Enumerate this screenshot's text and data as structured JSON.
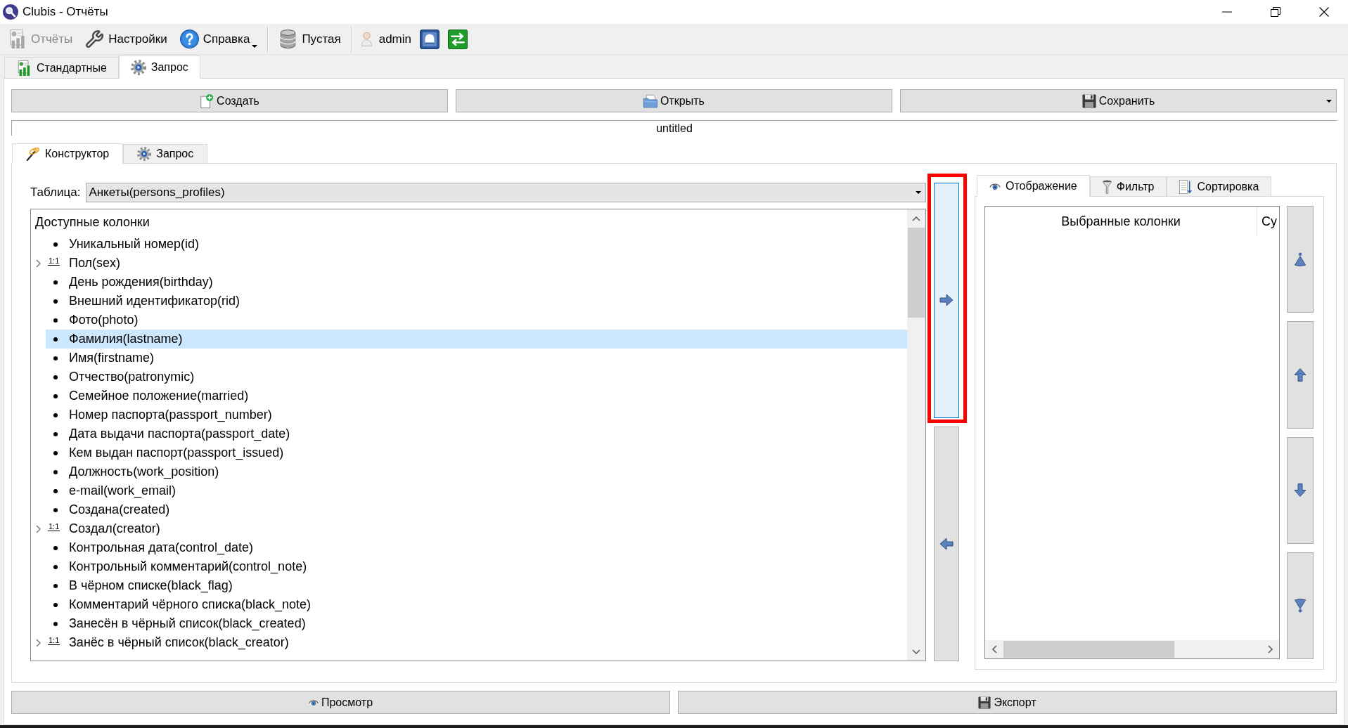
{
  "window": {
    "title": "Clubis - Отчёты"
  },
  "toolbar": [
    {
      "kind": "button",
      "label": "Отчёты",
      "disabled": true,
      "dropdown": false
    },
    {
      "kind": "button",
      "label": "Настройки",
      "disabled": false,
      "dropdown": false
    },
    {
      "kind": "button",
      "label": "Справка",
      "disabled": false,
      "dropdown": true
    },
    {
      "kind": "separator"
    },
    {
      "kind": "button",
      "label": "Пустая",
      "disabled": false,
      "dropdown": false
    },
    {
      "kind": "separator"
    },
    {
      "kind": "user",
      "label": "admin"
    },
    {
      "kind": "icon_button"
    },
    {
      "kind": "icon_button"
    }
  ],
  "main_tabs": [
    {
      "label": "Стандартные",
      "selected": false
    },
    {
      "label": "Запрос",
      "selected": true
    }
  ],
  "file_buttons": [
    {
      "label": "Создать",
      "dropdown": false
    },
    {
      "label": "Открыть",
      "dropdown": false
    },
    {
      "label": "Сохранить",
      "dropdown": true
    }
  ],
  "query_name": {
    "value": "untitled"
  },
  "editor_tabs": [
    {
      "label": "Конструктор",
      "selected": true
    },
    {
      "label": "Запрос",
      "selected": false
    }
  ],
  "table_select": {
    "label": "Таблица:",
    "value": "Анкеты(persons_profiles)"
  },
  "available_columns": {
    "header": "Доступные колонки",
    "items": [
      {
        "kind": "field",
        "label": "Уникальный номер(id)",
        "selected": false
      },
      {
        "kind": "relation",
        "label": "Пол(sex)",
        "relation": "1:1",
        "expanded": false,
        "selected": false
      },
      {
        "kind": "field",
        "label": "День рождения(birthday)",
        "selected": false
      },
      {
        "kind": "field",
        "label": "Внешний идентификатор(rid)",
        "selected": false
      },
      {
        "kind": "field",
        "label": "Фото(photo)",
        "selected": false
      },
      {
        "kind": "field",
        "label": "Фамилия(lastname)",
        "selected": true
      },
      {
        "kind": "field",
        "label": "Имя(firstname)",
        "selected": false
      },
      {
        "kind": "field",
        "label": "Отчество(patronymic)",
        "selected": false
      },
      {
        "kind": "field",
        "label": "Семейное положение(married)",
        "selected": false
      },
      {
        "kind": "field",
        "label": "Номер паспорта(passport_number)",
        "selected": false
      },
      {
        "kind": "field",
        "label": "Дата выдачи паспорта(passport_date)",
        "selected": false
      },
      {
        "kind": "field",
        "label": "Кем выдан паспорт(passport_issued)",
        "selected": false
      },
      {
        "kind": "field",
        "label": "Должность(work_position)",
        "selected": false
      },
      {
        "kind": "field",
        "label": "e-mail(work_email)",
        "selected": false
      },
      {
        "kind": "field",
        "label": "Создана(created)",
        "selected": false
      },
      {
        "kind": "relation",
        "label": "Создал(creator)",
        "relation": "1:1",
        "expanded": false,
        "selected": false
      },
      {
        "kind": "field",
        "label": "Контрольная дата(control_date)",
        "selected": false
      },
      {
        "kind": "field",
        "label": "Контрольный комментарий(control_note)",
        "selected": false
      },
      {
        "kind": "field",
        "label": "В чёрном списке(black_flag)",
        "selected": false
      },
      {
        "kind": "field",
        "label": "Комментарий чёрного списка(black_note)",
        "selected": false
      },
      {
        "kind": "field",
        "label": "Занесён в чёрный список(black_created)",
        "selected": false
      },
      {
        "kind": "relation",
        "label": "Занёс в чёрный список(black_creator)",
        "relation": "1:1",
        "expanded": false,
        "selected": false
      }
    ]
  },
  "move_buttons": [
    {
      "kind": "right",
      "hovered": true,
      "highlighted": true
    },
    {
      "kind": "left",
      "hovered": false,
      "highlighted": false
    }
  ],
  "output_tabs": [
    {
      "label": "Отображение",
      "selected": true
    },
    {
      "label": "Фильтр",
      "selected": false
    },
    {
      "label": "Сортировка",
      "selected": false
    }
  ],
  "selected_columns": {
    "columns": [
      "Выбранные колонки",
      "Су"
    ]
  },
  "order_buttons": [
    {
      "kind": "top"
    },
    {
      "kind": "up"
    },
    {
      "kind": "down"
    },
    {
      "kind": "bottom"
    }
  ],
  "action_buttons": [
    {
      "label": "Просмотр"
    },
    {
      "label": "Экспорт"
    }
  ]
}
